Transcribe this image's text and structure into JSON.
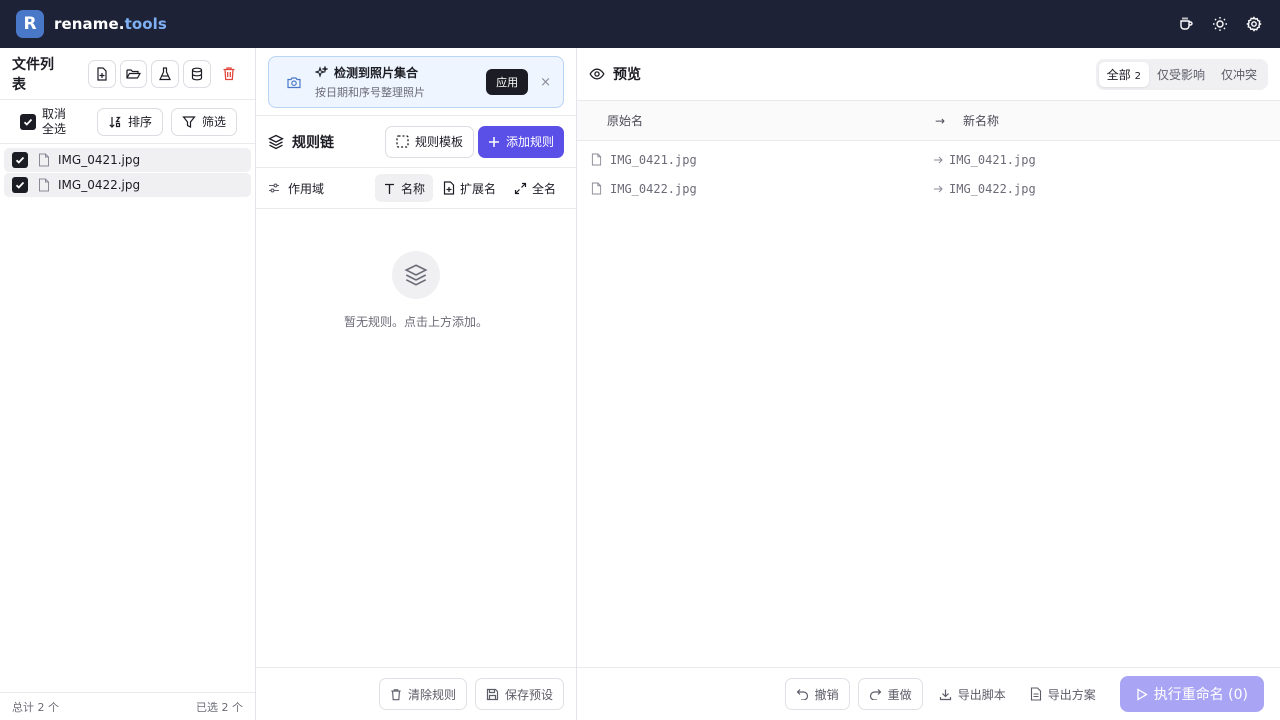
{
  "app": {
    "logo_letter": "R",
    "brand_main": "rename.",
    "brand_accent": "tools",
    "accent_color": "#5a4fe6",
    "topbar_bg": "#1d2236",
    "header_icons": [
      "coffee-icon",
      "sun-icon",
      "gear-icon"
    ]
  },
  "file_list": {
    "title": "文件列表",
    "toolbar_icons": [
      "add-file-icon",
      "folder-open-icon",
      "flask-icon",
      "database-icon",
      "trash-icon"
    ],
    "select_label_line1": "取消",
    "select_label_line2": "全选",
    "sort_label": "排序",
    "filter_label": "筛选",
    "files": [
      {
        "name": "IMG_0421.jpg",
        "checked": true
      },
      {
        "name": "IMG_0422.jpg",
        "checked": true
      }
    ],
    "total_label": "总计 2 个",
    "selected_label": "已选 2 个"
  },
  "banner": {
    "title": "检测到照片集合",
    "subtitle": "按日期和序号整理照片",
    "apply_label": "应用",
    "close_label": "×"
  },
  "rule_chain": {
    "title": "规则链",
    "template_label": "规则模板",
    "add_label": "添加规则",
    "scope_label": "作用域",
    "scope_tabs": [
      {
        "label": "名称",
        "active": true
      },
      {
        "label": "扩展名",
        "active": false
      },
      {
        "label": "全名",
        "active": false
      }
    ],
    "empty_text": "暂无规则。点击上方添加。",
    "clear_label": "清除规则",
    "save_label": "保存预设"
  },
  "preview": {
    "title": "预览",
    "filters": [
      {
        "label": "全部",
        "count": "2",
        "active": true
      },
      {
        "label": "仅受影响",
        "count": "",
        "active": false
      },
      {
        "label": "仅冲突",
        "count": "",
        "active": false
      }
    ],
    "col_original": "原始名",
    "col_arrow": "→",
    "col_new": "新名称",
    "rows": [
      {
        "original": "IMG_0421.jpg",
        "new": "IMG_0421.jpg"
      },
      {
        "original": "IMG_0422.jpg",
        "new": "IMG_0422.jpg"
      }
    ],
    "undo_label": "撤销",
    "redo_label": "重做",
    "export_script_label": "导出脚本",
    "export_plan_label": "导出方案",
    "execute_label": "执行重命名 (0)"
  }
}
